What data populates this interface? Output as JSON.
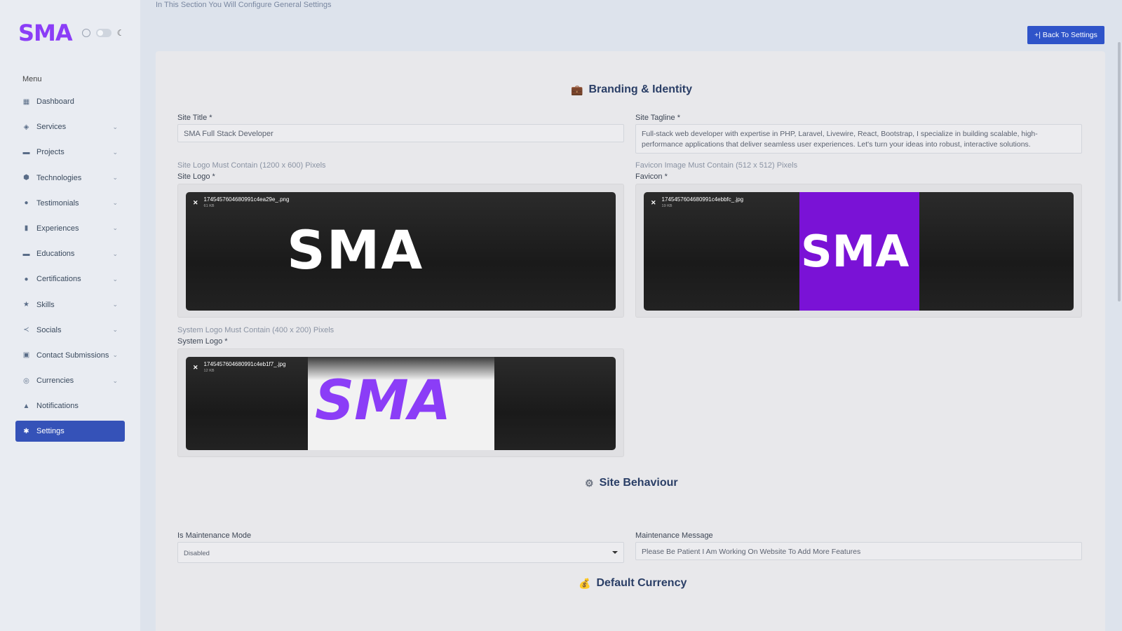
{
  "sidebar": {
    "brand": "SMA",
    "menu_label": "Menu",
    "items": [
      {
        "label": "Dashboard",
        "icon": "▦",
        "chevron": false,
        "active": false
      },
      {
        "label": "Services",
        "icon": "◈",
        "chevron": true,
        "active": false
      },
      {
        "label": "Projects",
        "icon": "▬",
        "chevron": true,
        "active": false
      },
      {
        "label": "Technologies",
        "icon": "⬢",
        "chevron": true,
        "active": false
      },
      {
        "label": "Testimonials",
        "icon": "●",
        "chevron": true,
        "active": false
      },
      {
        "label": "Experiences",
        "icon": "▮",
        "chevron": true,
        "active": false
      },
      {
        "label": "Educations",
        "icon": "▬",
        "chevron": true,
        "active": false
      },
      {
        "label": "Certifications",
        "icon": "●",
        "chevron": true,
        "active": false
      },
      {
        "label": "Skills",
        "icon": "★",
        "chevron": true,
        "active": false
      },
      {
        "label": "Socials",
        "icon": "≺",
        "chevron": true,
        "active": false
      },
      {
        "label": "Contact Submissions",
        "icon": "▣",
        "chevron": true,
        "active": false
      },
      {
        "label": "Currencies",
        "icon": "◎",
        "chevron": true,
        "active": false
      },
      {
        "label": "Notifications",
        "icon": "▲",
        "chevron": false,
        "active": false
      },
      {
        "label": "Settings",
        "icon": "✱",
        "chevron": false,
        "active": true
      }
    ]
  },
  "header": {
    "subtitle": "In This Section You Will Configure General Settings",
    "back_label": "+| Back To Settings"
  },
  "branding": {
    "title": "Branding & Identity",
    "site_title_label": "Site Title *",
    "site_title_value": "SMA Full Stack Developer",
    "site_tagline_label": "Site Tagline *",
    "site_tagline_value": "Full-stack web developer with expertise in PHP, Laravel, Livewire, React, Bootstrap, I specialize in building scalable, high-performance applications that deliver seamless user experiences. Let's turn your ideas into robust, interactive solutions.",
    "site_logo_hint": "Site Logo Must Contain (1200 x 600) Pixels",
    "site_logo_label": "Site Logo *",
    "site_logo_file": "1745457604680991c4ea29e_.png",
    "site_logo_size": "61 KB",
    "favicon_hint": "Favicon Image Must Contain (512 x 512) Pixels",
    "favicon_label": "Favicon *",
    "favicon_file": "1745457604680991c4ebbfc_.jpg",
    "favicon_size": "19 KB",
    "system_logo_hint": "System Logo Must Contain (400 x 200) Pixels",
    "system_logo_label": "System Logo *",
    "system_logo_file": "1745457604680991c4eb1f7_.jpg",
    "system_logo_size": "12 KB",
    "logo_text": "SMA"
  },
  "behaviour": {
    "title": "Site Behaviour",
    "maintenance_mode_label": "Is Maintenance Mode",
    "maintenance_mode_value": "Disabled",
    "maintenance_message_label": "Maintenance Message",
    "maintenance_message_value": "Please Be Patient I Am Working On Website To Add More Features"
  },
  "currency": {
    "title": "Default Currency"
  },
  "colors": {
    "accent": "#3552b8",
    "brand_purple": "#8b3df7",
    "favicon_bg": "#7a12d6"
  }
}
